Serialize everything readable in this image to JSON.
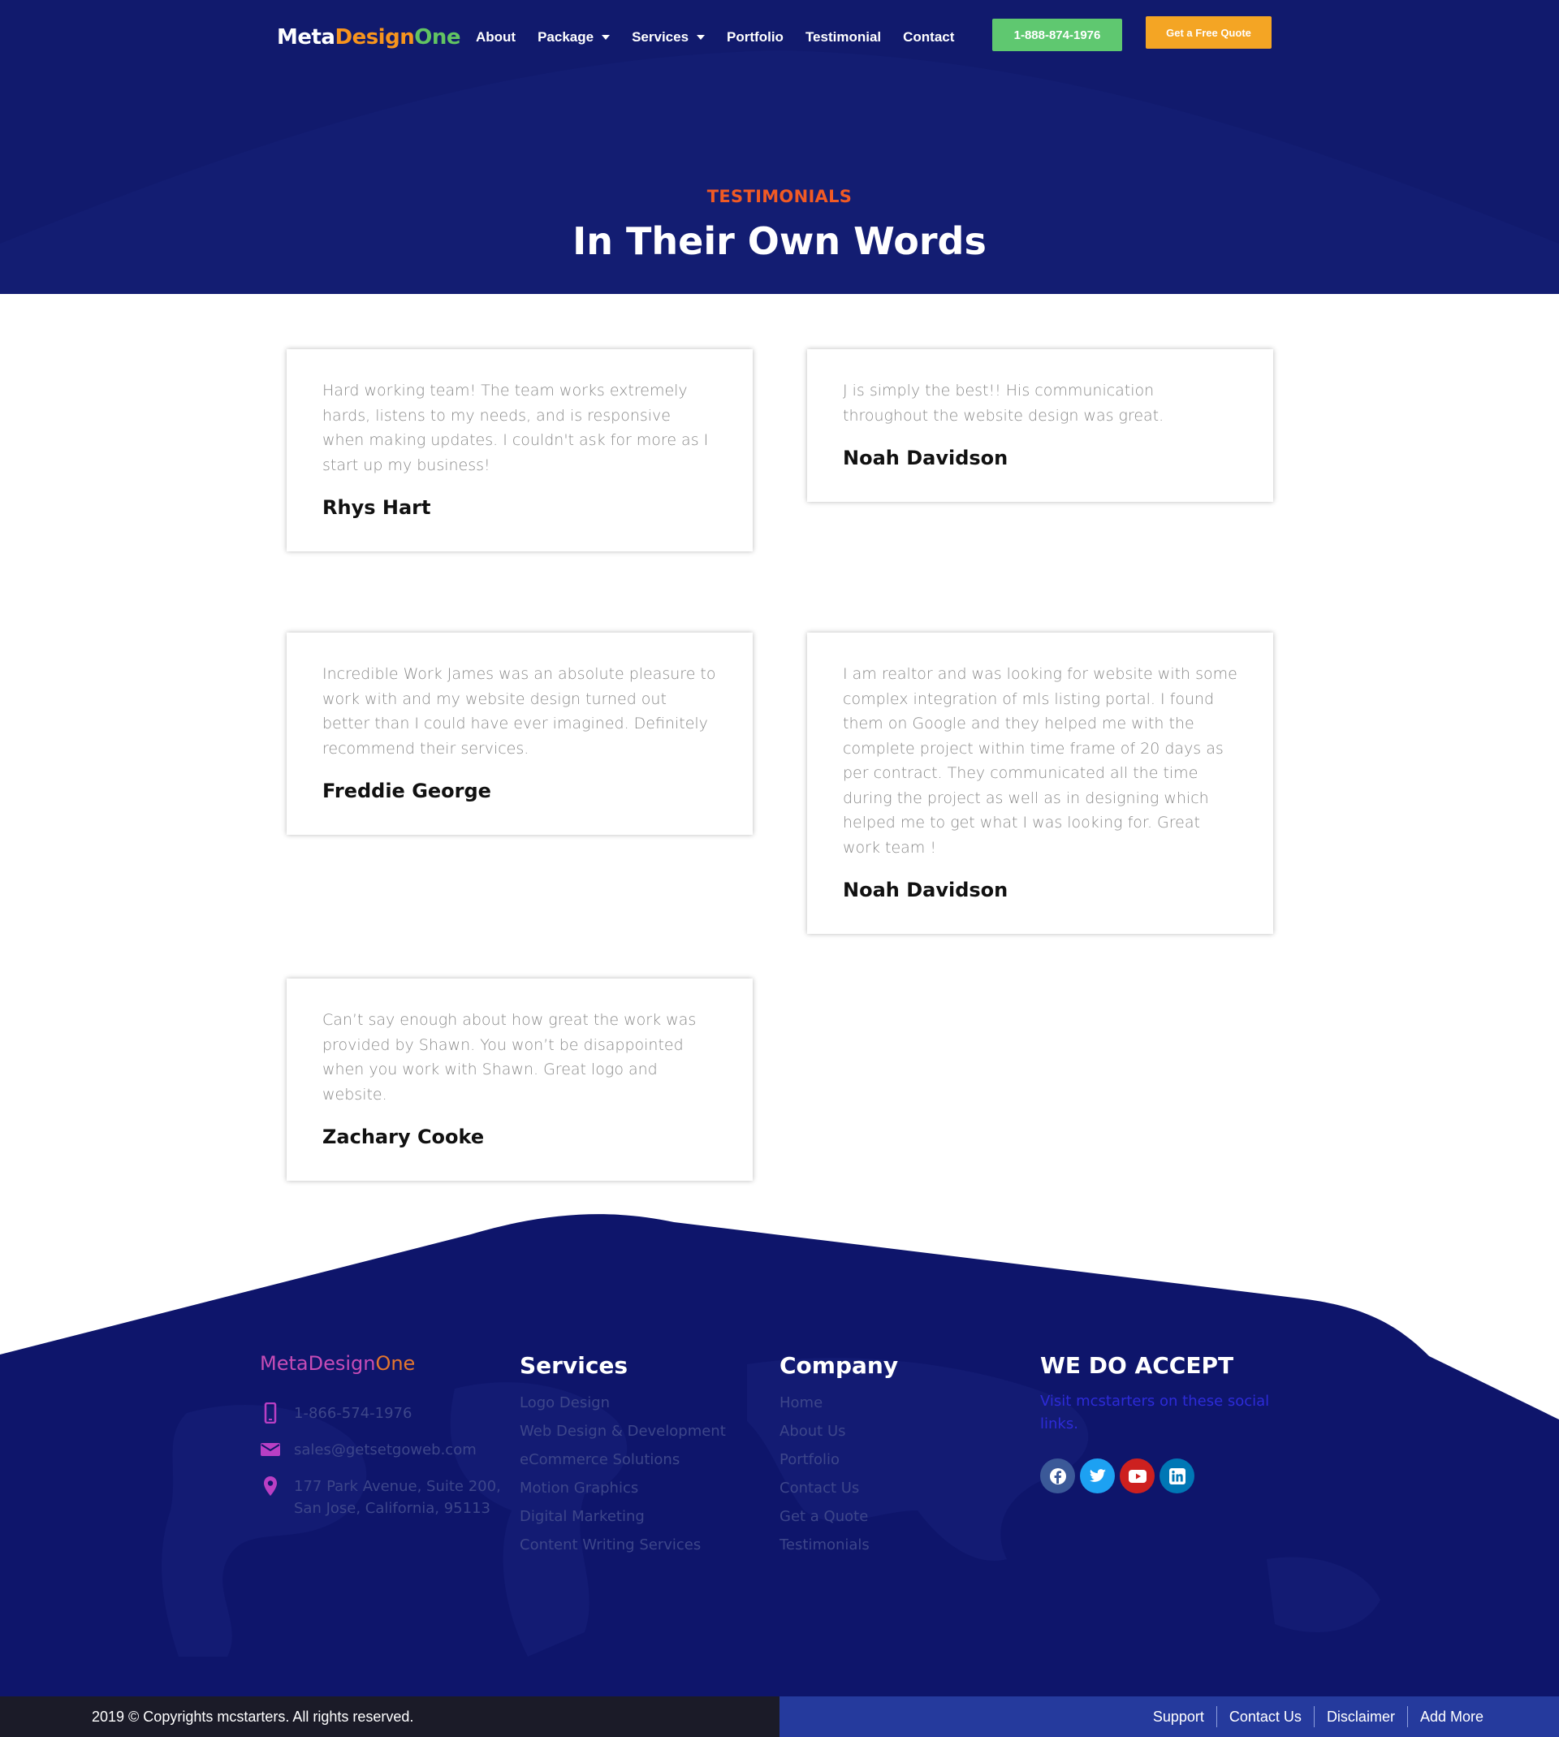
{
  "nav": {
    "logo_part1": "Meta",
    "logo_part2": "Design",
    "logo_part3": "One",
    "items": [
      {
        "label": "About",
        "has_dropdown": false
      },
      {
        "label": "Package",
        "has_dropdown": true
      },
      {
        "label": "Services",
        "has_dropdown": true
      },
      {
        "label": "Portfolio",
        "has_dropdown": false
      },
      {
        "label": "Testimonial",
        "has_dropdown": false
      },
      {
        "label": "Contact",
        "has_dropdown": false
      }
    ],
    "phone_button": "1-888-874-1976",
    "quote_button": "Get a Free Quote"
  },
  "hero": {
    "kicker": "TESTIMONIALS",
    "title": "In Their Own Words"
  },
  "testimonials": [
    {
      "text": "Hard working team! The team works extremely hards, listens to my needs, and is responsive when making updates. I couldn't ask for more as I start up my business!",
      "name": "Rhys Hart"
    },
    {
      "text": "J is simply the best!! His communication throughout the website design was great.",
      "name": "Noah Davidson"
    },
    {
      "text": "Incredible Work James was an absolute pleasure to work with and my website design turned out better than I could have ever imagined. Definitely recommend their services.",
      "name": "Freddie George"
    },
    {
      "text": "I am realtor and was looking for website with some complex integration of mls listing portal. I found them on Google and they helped me with the complete project within time frame of 20 days as per contract. They communicated all the time during the project as well as in designing which helped me to get what I was looking for. Great work team !",
      "name": "Noah Davidson"
    },
    {
      "text": "Can’t say enough about how great the work was provided by Shawn. You won’t be disappointed when you work with Shawn. Great logo and website.",
      "name": "Zachary Cooke"
    }
  ],
  "footer": {
    "brand_part1": "MetaDesign",
    "brand_part2": "One",
    "phone": "1-866-574-1976",
    "email": "sales@getsetgoweb.com",
    "address_line1": "177 Park Avenue, Suite 200,",
    "address_line2": "San Jose, California, 95113",
    "services_heading": "Services",
    "services": [
      "Logo Design",
      "Web Design & Development",
      "eCommerce Solutions",
      "Motion Graphics",
      "Digital Marketing",
      "Content Writing Services"
    ],
    "company_heading": "Company",
    "company": [
      "Home",
      "About Us",
      "Portfolio",
      "Contact Us",
      "Get a Quote",
      "Testimonials"
    ],
    "accept_heading": "WE DO ACCEPT",
    "accept_text": "Visit mcstarters on these social links.",
    "socials": [
      {
        "icon": "facebook-icon",
        "color": "#3b5998"
      },
      {
        "icon": "twitter-icon",
        "color": "#1da1f2"
      },
      {
        "icon": "youtube-icon",
        "color": "#cd201f"
      },
      {
        "icon": "linkedin-icon",
        "color": "#0077b5"
      }
    ],
    "copyright": "2019 © Copyrights mcstarters. All rights reserved.",
    "bottom_links": [
      "Support",
      "Contact Us",
      "Disclaimer",
      "Add More"
    ]
  },
  "colors": {
    "navy": "#111a6d",
    "accent_orange": "#f15a24",
    "phone_green": "#5fc870",
    "quote_orange": "#f4a524"
  }
}
